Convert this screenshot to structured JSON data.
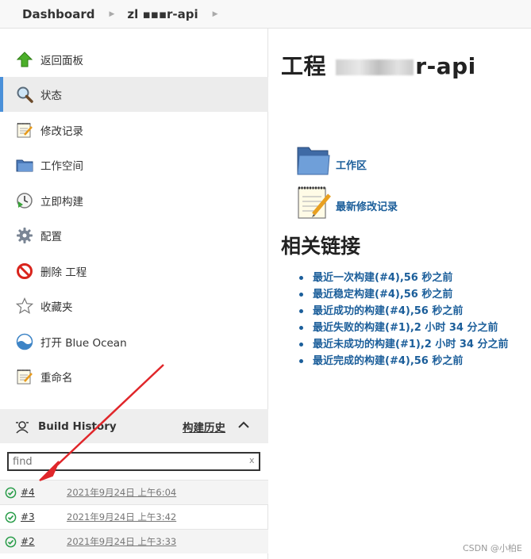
{
  "breadcrumb": {
    "dashboard": "Dashboard",
    "project": "zl  ▪▪▪r-api"
  },
  "sidebar": {
    "items": [
      {
        "label": "返回面板",
        "icon": "up-arrow-icon"
      },
      {
        "label": "状态",
        "icon": "magnifier-icon",
        "active": true
      },
      {
        "label": "修改记录",
        "icon": "notepad-icon"
      },
      {
        "label": "工作空间",
        "icon": "folder-icon"
      },
      {
        "label": "立即构建",
        "icon": "clock-play-icon"
      },
      {
        "label": "配置",
        "icon": "gear-icon"
      },
      {
        "label": "删除 工程",
        "icon": "no-entry-icon"
      },
      {
        "label": "收藏夹",
        "icon": "star-icon"
      },
      {
        "label": "打开 Blue Ocean",
        "icon": "blue-ocean-icon"
      },
      {
        "label": "重命名",
        "icon": "notepad-pencil-icon"
      }
    ]
  },
  "build_history": {
    "title": "Build History",
    "trend_label": "构建历史",
    "find_placeholder": "find",
    "clear_label": "x",
    "builds": [
      {
        "number": "#4",
        "date": "2021年9月24日 上午6:04"
      },
      {
        "number": "#3",
        "date": "2021年9月24日 上午3:42"
      },
      {
        "number": "#2",
        "date": "2021年9月24日 上午3:33"
      }
    ]
  },
  "main": {
    "title_prefix": "工程",
    "title_suffix": "r-api",
    "workspace_link": "工作区",
    "changes_link": "最新修改记录",
    "related_title": "相关链接",
    "related_links": [
      "最近一次构建(#4),56 秒之前",
      "最近稳定构建(#4),56 秒之前",
      "最近成功的构建(#4),56 秒之前",
      "最近失败的构建(#1),2 小时 34 分之前",
      "最近未成功的构建(#1),2 小时 34 分之前",
      "最近完成的构建(#4),56 秒之前"
    ]
  },
  "watermark": "CSDN @小柏E",
  "colors": {
    "link": "#1b5e9a",
    "success": "#2a9d4a",
    "annotation_arrow": "#e0262a"
  }
}
